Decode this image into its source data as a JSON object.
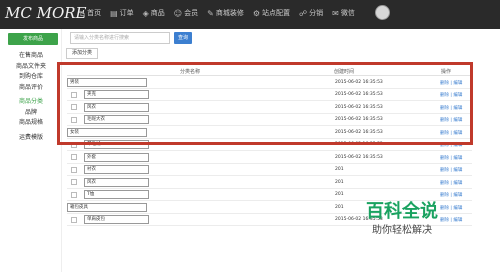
{
  "brand": {
    "logo": "MC MORE"
  },
  "nav": [
    {
      "icon": "home-icon",
      "glyph": "⌂",
      "label": "首页"
    },
    {
      "icon": "order-icon",
      "glyph": "▤",
      "label": "订单"
    },
    {
      "icon": "goods-icon",
      "glyph": "◈",
      "label": "商品"
    },
    {
      "icon": "user-icon",
      "glyph": "☺",
      "label": "会员"
    },
    {
      "icon": "decor-icon",
      "glyph": "✎",
      "label": "商城装修"
    },
    {
      "icon": "config-icon",
      "glyph": "⚙",
      "label": "站点配置"
    },
    {
      "icon": "share-icon",
      "glyph": "☍",
      "label": "分销"
    },
    {
      "icon": "wechat-icon",
      "glyph": "✉",
      "label": "微信"
    }
  ],
  "sidebar": {
    "primary_button": "发布商品",
    "groups": [
      [
        "在售商品",
        "商品文件夹",
        "到购仓库",
        "商品评价"
      ],
      [
        "商品分类",
        "品牌",
        "商品规格"
      ],
      [
        "运费模版"
      ]
    ],
    "active": "商品分类"
  },
  "toolbar": {
    "search_placeholder": "请输入分类名称进行搜索",
    "search_button": "查询",
    "add_button": "添加分类"
  },
  "table": {
    "headers": {
      "name": "分类名称",
      "time": "创建时间",
      "ops": "操作"
    },
    "ops_label": "删除 | 编辑",
    "rows": [
      {
        "name": "男装",
        "time": "2015-06-02 16:35:53",
        "level": 0,
        "checkbox": false
      },
      {
        "name": "夹克",
        "time": "2015-06-02 16:35:53",
        "level": 1,
        "checkbox": true
      },
      {
        "name": "风衣",
        "time": "2015-06-02 16:35:53",
        "level": 1,
        "checkbox": true
      },
      {
        "name": "毛呢大衣",
        "time": "2015-06-02 16:35:53",
        "level": 1,
        "checkbox": true
      },
      {
        "name": "女装",
        "time": "2015-06-02 16:35:53",
        "level": 0,
        "checkbox": false
      },
      {
        "name": "羊毛绒",
        "time": "2015-06-02 16:35:53",
        "level": 1,
        "checkbox": true
      },
      {
        "name": "外套",
        "time": "2015-06-02 16:35:53",
        "level": 1,
        "checkbox": true
      },
      {
        "name": "衬衣",
        "time": "201",
        "level": 1,
        "checkbox": true
      },
      {
        "name": "风衣",
        "time": "201",
        "level": 1,
        "checkbox": true
      },
      {
        "name": "T恤",
        "time": "201",
        "level": 1,
        "checkbox": true
      },
      {
        "name": "箱包皮具",
        "time": "201",
        "level": 0,
        "checkbox": false
      },
      {
        "name": "单肩皮包",
        "time": "2015-06-02 16:35:53",
        "level": 1,
        "checkbox": true
      }
    ]
  },
  "watermark": {
    "title": "百科全说",
    "subtitle": "助你轻松解决"
  }
}
